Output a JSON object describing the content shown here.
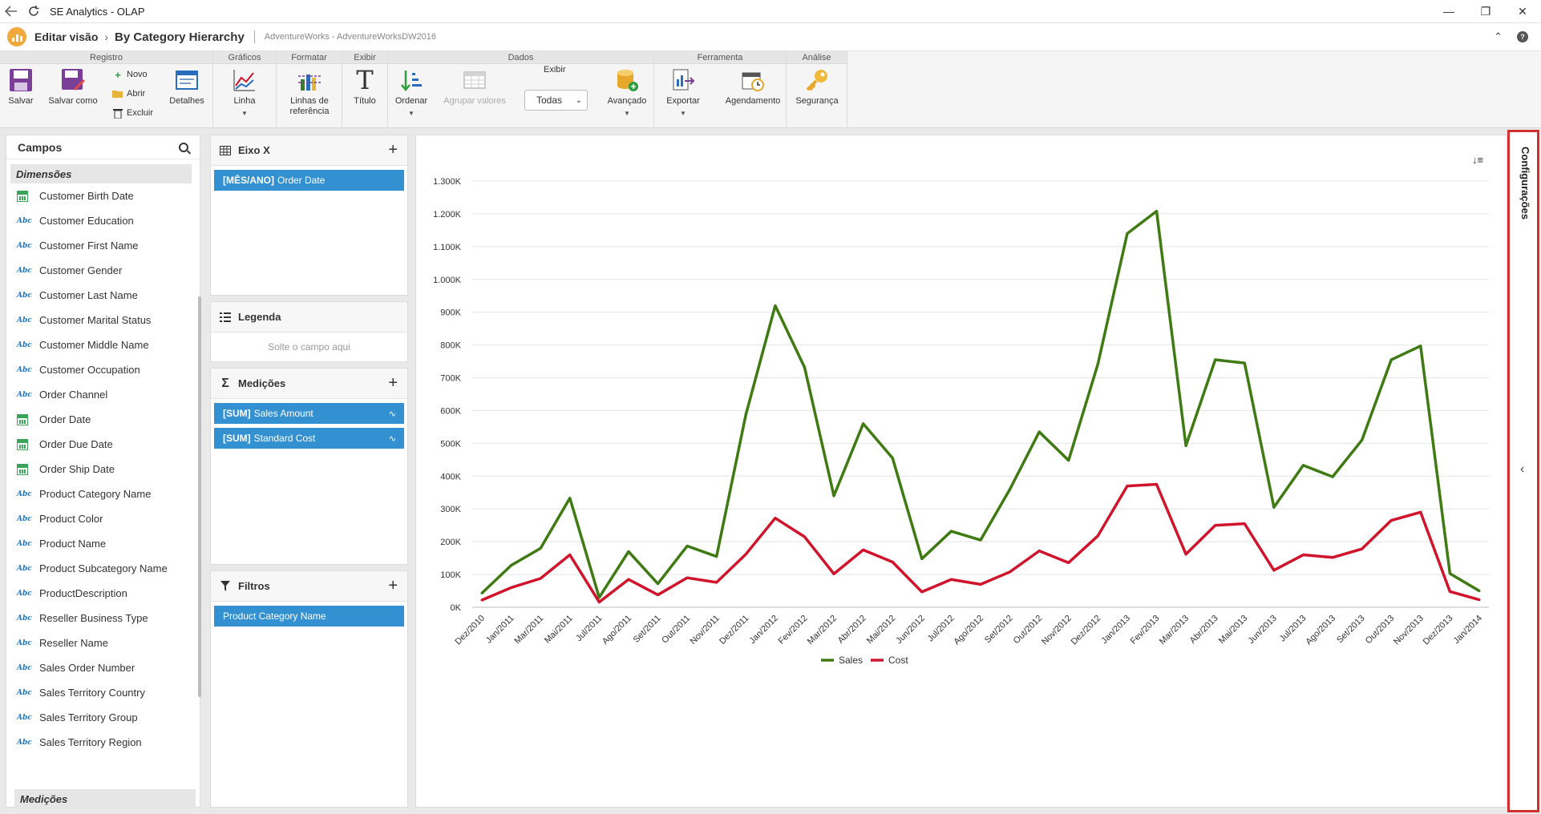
{
  "window": {
    "title": "SE Analytics - OLAP"
  },
  "header": {
    "crumb1": "Editar visão",
    "crumb2": "By Category Hierarchy",
    "crumb3": "AdventureWorks - AdventureWorksDW2016"
  },
  "ribbon": {
    "groups": {
      "registro": "Registro",
      "graficos": "Gráficos",
      "formatar": "Formatar",
      "exibir": "Exibir",
      "dados": "Dados",
      "ferramenta": "Ferramenta",
      "analise": "Análise"
    },
    "salvar": "Salvar",
    "salvar_como": "Salvar como",
    "novo": "Novo",
    "abrir": "Abrir",
    "excluir": "Excluir",
    "detalhes": "Detalhes",
    "linha": "Linha",
    "linhas_ref_1": "Linhas de",
    "linhas_ref_2": "referência",
    "titulo": "Título",
    "ordenar": "Ordenar",
    "agrupar": "Agrupar valores",
    "exibir_label": "Exibir",
    "exibir_value": "Todas",
    "avancado": "Avançado",
    "exportar": "Exportar",
    "agendamento": "Agendamento",
    "seguranca": "Segurança"
  },
  "campos": {
    "title": "Campos",
    "dimensoes": "Dimensões",
    "medicoes": "Medições",
    "fields": [
      {
        "label": "Customer Birth Date",
        "type": "date"
      },
      {
        "label": "Customer Education",
        "type": "text"
      },
      {
        "label": "Customer First Name",
        "type": "text"
      },
      {
        "label": "Customer Gender",
        "type": "text"
      },
      {
        "label": "Customer Last Name",
        "type": "text"
      },
      {
        "label": "Customer Marital Status",
        "type": "text"
      },
      {
        "label": "Customer Middle Name",
        "type": "text"
      },
      {
        "label": "Customer Occupation",
        "type": "text"
      },
      {
        "label": "Order Channel",
        "type": "text"
      },
      {
        "label": "Order Date",
        "type": "date"
      },
      {
        "label": "Order Due Date",
        "type": "date"
      },
      {
        "label": "Order Ship Date",
        "type": "date"
      },
      {
        "label": "Product Category Name",
        "type": "text"
      },
      {
        "label": "Product Color",
        "type": "text"
      },
      {
        "label": "Product Name",
        "type": "text"
      },
      {
        "label": "Product Subcategory Name",
        "type": "text"
      },
      {
        "label": "ProductDescription",
        "type": "text"
      },
      {
        "label": "Reseller Business Type",
        "type": "text"
      },
      {
        "label": "Reseller Name",
        "type": "text"
      },
      {
        "label": "Sales Order Number",
        "type": "text"
      },
      {
        "label": "Sales Territory Country",
        "type": "text"
      },
      {
        "label": "Sales Territory Group",
        "type": "text"
      },
      {
        "label": "Sales Territory Region",
        "type": "text"
      }
    ]
  },
  "panels": {
    "eixo_x": {
      "title": "Eixo X",
      "chip_prefix": "[MÊS/ANO]",
      "chip_label": "Order Date"
    },
    "legenda": {
      "title": "Legenda",
      "drop": "Solte o campo aqui"
    },
    "medicoes": {
      "title": "Medições",
      "chips": [
        {
          "prefix": "[SUM]",
          "label": "Sales Amount"
        },
        {
          "prefix": "[SUM]",
          "label": "Standard Cost"
        }
      ]
    },
    "filtros": {
      "title": "Filtros",
      "chip_label": "Product Category Name"
    }
  },
  "config": {
    "label": "Configurações"
  },
  "colors": {
    "sales": "#3f7a12",
    "cost": "#d0142c",
    "chip": "#3391d1"
  },
  "chart_data": {
    "type": "line",
    "categories": [
      "Dez/2010",
      "Jan/2011",
      "Mar/2011",
      "Mai/2011",
      "Jul/2011",
      "Ago/2011",
      "Set/2011",
      "Out/2011",
      "Nov/2011",
      "Dez/2011",
      "Jan/2012",
      "Fev/2012",
      "Mar/2012",
      "Abr/2012",
      "Mai/2012",
      "Jun/2012",
      "Jul/2012",
      "Ago/2012",
      "Set/2012",
      "Out/2012",
      "Nov/2012",
      "Dez/2012",
      "Jan/2013",
      "Fev/2013",
      "Mar/2013",
      "Abr/2013",
      "Mai/2013",
      "Jun/2013",
      "Jul/2013",
      "Ago/2013",
      "Set/2013",
      "Out/2013",
      "Nov/2013",
      "Dez/2013",
      "Jan/2014"
    ],
    "series": [
      {
        "name": "Sales",
        "values": [
          43000,
          128000,
          180000,
          333000,
          30000,
          170000,
          72000,
          187000,
          155000,
          588000,
          920000,
          732000,
          340000,
          560000,
          455000,
          148000,
          232000,
          205000,
          360000,
          535000,
          448000,
          742000,
          1140000,
          1208000,
          493000,
          755000,
          745000,
          305000,
          433000,
          398000,
          510000,
          755000,
          797000,
          103000,
          50000
        ]
      },
      {
        "name": "Cost",
        "values": [
          22000,
          60000,
          88000,
          160000,
          16000,
          85000,
          38000,
          90000,
          76000,
          162000,
          272000,
          215000,
          102000,
          175000,
          138000,
          47000,
          85000,
          70000,
          108000,
          172000,
          136000,
          218000,
          370000,
          375000,
          162000,
          250000,
          255000,
          113000,
          160000,
          152000,
          178000,
          265000,
          290000,
          48000,
          23000
        ]
      }
    ],
    "yticks": [
      "0K",
      "100K",
      "200K",
      "300K",
      "400K",
      "500K",
      "600K",
      "700K",
      "800K",
      "900K",
      "1.000K",
      "1.100K",
      "1.200K",
      "1.300K"
    ],
    "ylim": [
      0,
      1300000
    ],
    "grid": true,
    "legend": "bottom-center"
  }
}
